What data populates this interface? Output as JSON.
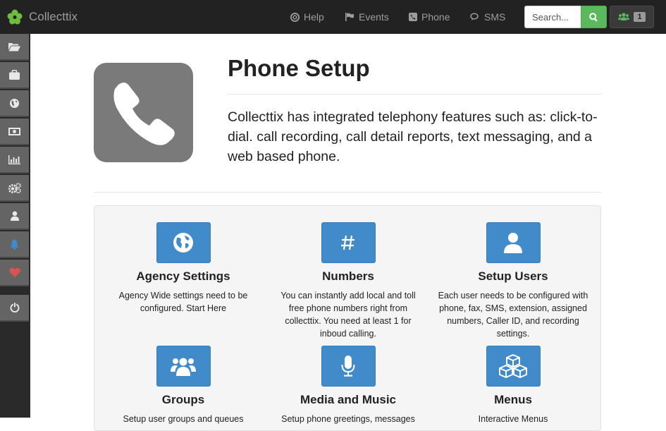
{
  "brand": {
    "name": "Collecttix"
  },
  "nav": {
    "help": "Help",
    "events": "Events",
    "phone": "Phone",
    "sms": "SMS"
  },
  "search": {
    "placeholder": "Search..."
  },
  "users": {
    "count": "1"
  },
  "sidebar": {
    "items": [
      {
        "icon": "folder-open-icon"
      },
      {
        "icon": "briefcase-icon"
      },
      {
        "icon": "globe-icon"
      },
      {
        "icon": "money-icon"
      },
      {
        "icon": "bar-chart-icon"
      },
      {
        "icon": "gears-icon"
      },
      {
        "icon": "user-icon"
      },
      {
        "icon": "bell-icon"
      },
      {
        "icon": "heart-icon"
      },
      {
        "icon": "power-icon"
      }
    ]
  },
  "page": {
    "title": "Phone Setup",
    "lead": "Collecttix has integrated telephony features such as: click-to-dial. call recording, call detail reports, text messaging, and a web based phone."
  },
  "cards": [
    {
      "title": "Agency Settings",
      "text": "Agency Wide settings need to be configured. Start Here",
      "icon": "globe-icon"
    },
    {
      "title": "Numbers",
      "text": "You can instantly add local and toll free phone numbers right from collecttix. You need at least 1 for inboud calling.",
      "icon": "hash-icon"
    },
    {
      "title": "Setup Users",
      "text": "Each user needs to be configured with phone, fax, SMS, extension, assigned numbers, Caller ID, and recording settings.",
      "icon": "user-icon"
    },
    {
      "title": "Groups",
      "text": "Setup user groups and queues",
      "icon": "group-icon"
    },
    {
      "title": "Media and Music",
      "text": "Setup phone greetings, messages",
      "icon": "microphone-icon"
    },
    {
      "title": "Menus",
      "text": "Interactive Menus",
      "icon": "cubes-icon"
    }
  ],
  "colors": {
    "topbar": "#222222",
    "accent_blue": "#428bca",
    "search_green": "#5cb85c",
    "hero_icon_bg": "#7a7a7a",
    "bell": "#428bca",
    "heart": "#d9534f"
  }
}
